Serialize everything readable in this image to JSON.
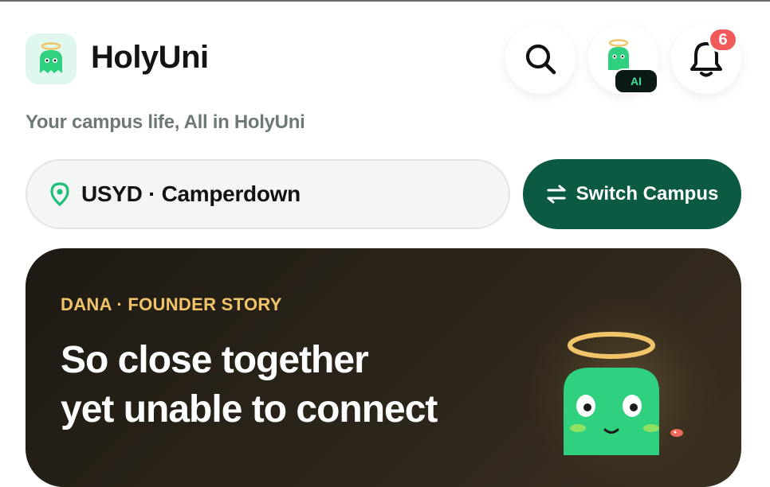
{
  "header": {
    "app_name": "HolyUni",
    "tagline": "Your campus life, All in HolyUni",
    "app_icon": "ghost-mascot-icon"
  },
  "actions": {
    "search_icon": "search-icon",
    "ai_button": {
      "icon": "ghost-mascot-icon",
      "label": "AI"
    },
    "notifications": {
      "icon": "bell-icon",
      "count": "6"
    }
  },
  "campus": {
    "current": "USYD · Camperdown",
    "pin_icon": "location-pin-icon",
    "switch_label": "Switch Campus",
    "switch_icon": "swap-arrows-icon"
  },
  "banner": {
    "kicker": "DANA · FOUNDER STORY",
    "title_line1": "So close together",
    "title_line2": "yet unable to connect"
  },
  "colors": {
    "brand_green": "#0c5a43",
    "mascot_green": "#2fd07e",
    "accent_gold": "#f2c46a",
    "badge_red": "#f05a5a"
  }
}
